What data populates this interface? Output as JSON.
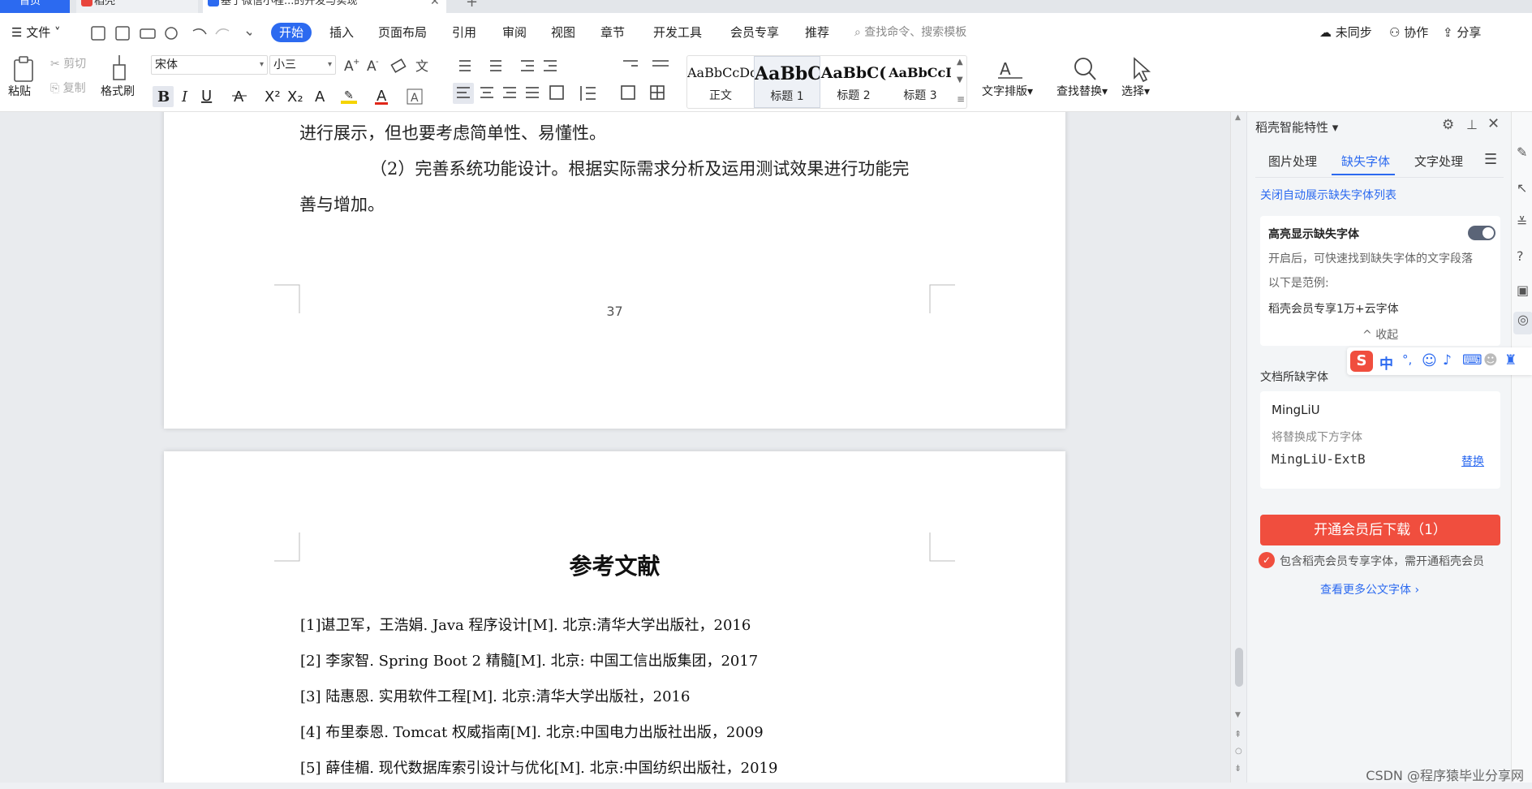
{
  "tabs": {
    "home": "首页",
    "daoke": "稻壳",
    "doc": "基于微信小程...的开发与实现"
  },
  "menu": {
    "file": "文件",
    "items": [
      "开始",
      "插入",
      "页面布局",
      "引用",
      "审阅",
      "视图",
      "章节",
      "开发工具",
      "会员专享",
      "推荐"
    ],
    "search": "查找命令、搜索模板",
    "sync": "未同步",
    "collab": "协作",
    "share": "分享"
  },
  "ribbon": {
    "paste": "粘贴",
    "cut": "剪切",
    "copy": "复制",
    "format_painter": "格式刷",
    "font_name": "宋体",
    "font_size": "小三",
    "text_layout": "文字排版",
    "find_replace": "查找替换",
    "select": "选择",
    "styles": [
      {
        "preview": "AaBbCcDd",
        "name": "正文"
      },
      {
        "preview": "AaBbC",
        "name": "标题 1"
      },
      {
        "preview": "AaBbC(",
        "name": "标题 2"
      },
      {
        "preview": "AaBbCcI",
        "name": "标题 3"
      }
    ]
  },
  "page1": {
    "line1": "进行展示，但也要考虑简单性、易懂性。",
    "line2": "（2）完善系统功能设计。根据实际需求分析及运用测试效果进行功能完",
    "line3": "善与增加。",
    "page_number": "37"
  },
  "page2": {
    "title": "参考文献",
    "refs": [
      "[1]谌卫军，王浩娟. Java 程序设计[M]. 北京:清华大学出版社，2016",
      "[2]  李家智. Spring Boot 2 精髓[M]. 北京: 中国工信出版集团，2017",
      "[3]  陆惠恩. 实用软件工程[M]. 北京:清华大学出版社，2016",
      "[4]  布里泰恩. Tomcat 权威指南[M]. 北京:中国电力出版社出版，2009",
      "[5]  薛佳楣. 现代数据库索引设计与优化[M]. 北京:中国纺织出版社，2019"
    ]
  },
  "panel": {
    "title": "稻壳智能特性",
    "tabs": [
      "图片处理",
      "缺失字体",
      "文字处理"
    ],
    "close_auto": "关闭自动展示缺失字体列表",
    "highlight_title": "高亮显示缺失字体",
    "highlight_desc": "开启后，可快速找到缺失字体的文字段落",
    "example_label": "以下是范例:",
    "example_text": "稻壳会员专享1万+云字体",
    "collapse": "收起",
    "missing_label": "文档所缺字体",
    "missing_font": "MingLiU",
    "replace_hint": "将替换成下方字体",
    "replacement_font": "MingLiU-ExtB",
    "replace_link": "替换",
    "download_btn": "开通会员后下载（1）",
    "note": "包含稻壳会员专享字体，需开通稻壳会员",
    "more_link": "查看更多公文字体"
  },
  "ime": {
    "lang": "中",
    "punct": "°,"
  },
  "watermark": "CSDN @程序猿毕业分享网"
}
